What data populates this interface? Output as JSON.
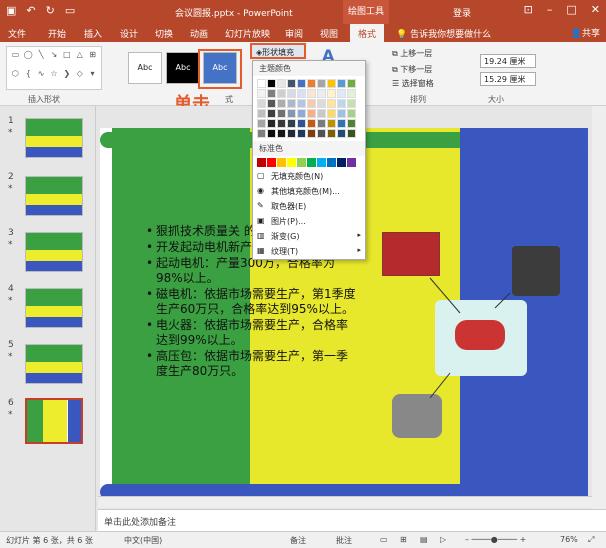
{
  "titlebar": {
    "doc_title": "会议圆报.pptx - PowerPoint",
    "tool_tab": "绘图工具",
    "signin": "登录",
    "qa_icons": [
      "save-icon",
      "undo-icon",
      "redo-icon",
      "start-icon"
    ],
    "window_buttons": [
      "ribbon-display-icon",
      "minimize-icon",
      "maximize-icon",
      "close-icon"
    ]
  },
  "tabs": [
    "文件",
    "开始",
    "插入",
    "设计",
    "切换",
    "动画",
    "幻灯片放映",
    "审阅",
    "视图",
    "格式"
  ],
  "active_tab": "格式",
  "tell_me": "告诉我你想要做什么",
  "share": "共享",
  "ribbon": {
    "insert_shapes_label": "插入形状",
    "style_samples": [
      "Abc",
      "Abc",
      "Abc"
    ],
    "shape_fill_button": "形状填充",
    "wordart_glyph": "A",
    "annotation": "单击",
    "styles_label": "式",
    "arrange_label": "排列",
    "bring_forward": "上移一层",
    "send_backward": "下移一层",
    "selection_pane": "选择窗格",
    "size_label": "大小",
    "height_value": "19.24 厘米",
    "width_value": "15.29 厘米"
  },
  "dropdown": {
    "theme_colors_label": "主题颜色",
    "standard_colors_label": "标准色",
    "theme_colors": [
      [
        "#ffffff",
        "#000000",
        "#e7e6e6",
        "#44546a",
        "#4472c4",
        "#ed7d31",
        "#a5a5a5",
        "#ffc000",
        "#5b9bd5",
        "#70ad47"
      ],
      [
        "#f2f2f2",
        "#7f7f7f",
        "#d0cece",
        "#d6dce4",
        "#d9e2f3",
        "#fbe5d5",
        "#ededed",
        "#fff2cc",
        "#deebf6",
        "#e2efd9"
      ],
      [
        "#d8d8d8",
        "#595959",
        "#aeabab",
        "#adb9ca",
        "#b4c6e7",
        "#f7cbac",
        "#dbdbdb",
        "#fee599",
        "#bdd7ee",
        "#c5e0b3"
      ],
      [
        "#bfbfbf",
        "#3f3f3f",
        "#757070",
        "#8496b0",
        "#8eaadb",
        "#f4b183",
        "#c9c9c9",
        "#ffd965",
        "#9cc3e5",
        "#a8d08d"
      ],
      [
        "#a5a5a5",
        "#262626",
        "#3a3838",
        "#323f4f",
        "#2f5496",
        "#c55a11",
        "#7b7b7b",
        "#bf9000",
        "#2e75b5",
        "#538135"
      ],
      [
        "#7f7f7f",
        "#0c0c0c",
        "#171616",
        "#222a35",
        "#1f3864",
        "#833c0b",
        "#525252",
        "#7f6000",
        "#1e4e79",
        "#375623"
      ]
    ],
    "standard_colors": [
      "#c00000",
      "#ff0000",
      "#ffc000",
      "#ffff00",
      "#92d050",
      "#00b050",
      "#00b0f0",
      "#0070c0",
      "#002060",
      "#7030a0"
    ],
    "items": [
      {
        "label": "无填充颜色(N)",
        "icon": "no-fill-icon",
        "arrow": ""
      },
      {
        "label": "其他填充颜色(M)...",
        "icon": "palette-icon",
        "arrow": ""
      },
      {
        "label": "取色器(E)",
        "icon": "eyedropper-icon",
        "arrow": ""
      },
      {
        "label": "图片(P)...",
        "icon": "picture-icon",
        "arrow": ""
      },
      {
        "label": "渐变(G)",
        "icon": "gradient-icon",
        "arrow": "▸"
      },
      {
        "label": "纹理(T)",
        "icon": "texture-icon",
        "arrow": "▸"
      }
    ]
  },
  "thumbnails": [
    {
      "num": "1",
      "star": "*"
    },
    {
      "num": "2",
      "star": "*"
    },
    {
      "num": "3",
      "star": "*"
    },
    {
      "num": "4",
      "star": "*"
    },
    {
      "num": "5",
      "star": "*"
    },
    {
      "num": "6",
      "star": "*"
    }
  ],
  "slide": {
    "bullets": [
      "狠抓技术质量关 的情况下，开发",
      "开发起动电机新产品。",
      "起动电机：产量300万，合格率为98%以上。",
      "磁电机：依据市场需要生产，第1季度生产60万只，合格率达到95%以上。",
      "电火器：依据市场需要生产，合格率达到99%以上。",
      "高压包：依据市场需要生产，第一季度生产80万只。"
    ]
  },
  "notes_placeholder": "单击此处添加备注",
  "status": {
    "slide_info": "幻灯片 第 6 张，共 6 张",
    "language": "中文(中国)",
    "notes": "备注",
    "comments": "批注",
    "zoom": "76%"
  }
}
